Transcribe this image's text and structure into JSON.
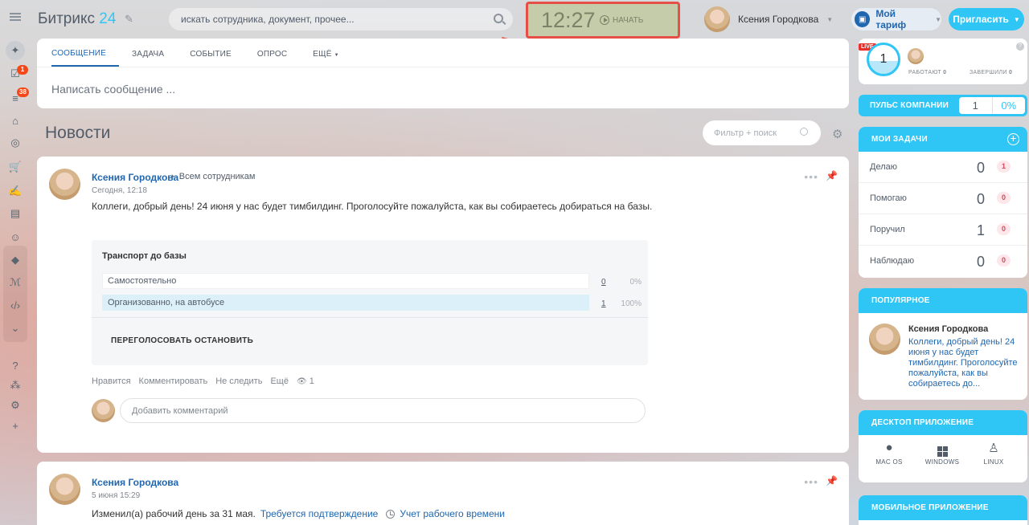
{
  "header": {
    "logo_main": "Битрикс",
    "logo_num": "24",
    "search_placeholder": "искать сотрудника, документ, прочее...",
    "clock_time": "12:27",
    "clock_start": "НАЧАТЬ",
    "user_name": "Ксения Городкова",
    "tariff_label": "Мой тариф",
    "invite_label": "Пригласить"
  },
  "sidebar": {
    "badges": {
      "tasks": "1",
      "feed": "38"
    }
  },
  "composer": {
    "tabs": [
      "СООБЩЕНИЕ",
      "ЗАДАЧА",
      "СОБЫТИЕ",
      "ОПРОС",
      "ЕЩЁ"
    ],
    "placeholder": "Написать сообщение ..."
  },
  "news": {
    "title": "Новости",
    "filter_placeholder": "Фильтр + поиск"
  },
  "post1": {
    "author": "Ксения Городкова",
    "recipients": "Всем сотрудникам",
    "time": "Сегодня, 12:18",
    "text": "Коллеги, добрый день! 24 июня у нас будет тимбилдинг. Проголосуйте пожалуйста, как вы собираетесь добираться на базы.",
    "vote": {
      "title": "Транспорт до базы",
      "options": [
        {
          "label": "Самостоятельно",
          "count": "0",
          "percent": "0%"
        },
        {
          "label": "Организованно, на автобусе",
          "count": "1",
          "percent": "100%"
        }
      ],
      "revote": "ПЕРЕГОЛОСОВАТЬ",
      "stop": "ОСТАНОВИТЬ"
    },
    "actions": {
      "like": "Нравится",
      "comment": "Комментировать",
      "unfollow": "Не следить",
      "more": "Ещё",
      "views": "1"
    },
    "comment_placeholder": "Добавить комментарий"
  },
  "post2": {
    "author": "Ксения Городкова",
    "time": "5 июня 15:29",
    "text": "Изменил(а) рабочий день за 31 мая.",
    "link": "Требуется подтверждение",
    "tracker": "Учет рабочего времени"
  },
  "right": {
    "live": {
      "badge": "LIVE",
      "count": "1",
      "working": "РАБОТАЮТ",
      "working_n": "0",
      "finished": "ЗАВЕРШИЛИ",
      "finished_n": "0"
    },
    "pulse": {
      "label": "ПУЛЬС КОМПАНИИ",
      "value": "1",
      "percent": "0%"
    },
    "tasks": {
      "title": "МОИ ЗАДАЧИ",
      "rows": [
        {
          "label": "Делаю",
          "count": "0",
          "badge": "1"
        },
        {
          "label": "Помогаю",
          "count": "0",
          "badge": "0"
        },
        {
          "label": "Поручил",
          "count": "1",
          "badge": "0"
        },
        {
          "label": "Наблюдаю",
          "count": "0",
          "badge": "0"
        }
      ]
    },
    "popular": {
      "title": "ПОПУЛЯРНОЕ",
      "author": "Ксения Городкова",
      "text": "Коллеги, добрый день! 24 июня у нас будет тимбилдинг. Проголосуйте пожалуйста, как вы собираетесь до..."
    },
    "desktop": {
      "title": "ДЕСКТОП ПРИЛОЖЕНИЕ",
      "mac": "MAC OS",
      "windows": "WINDOWS",
      "linux": "LINUX"
    },
    "mobile": {
      "title": "МОБИЛЬНОЕ ПРИЛОЖЕНИЕ"
    }
  },
  "colors": {
    "accent": "#2fc6f6",
    "link": "#2067b0",
    "highlight_border": "#e64f45"
  }
}
